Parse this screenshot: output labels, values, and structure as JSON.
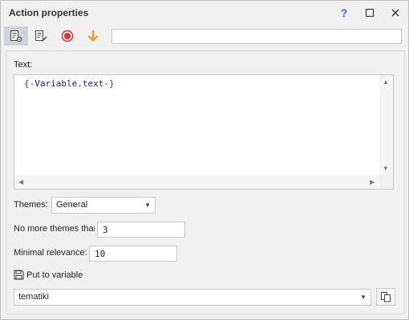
{
  "window": {
    "title": "Action properties",
    "help_glyph": "?",
    "maximize_glyph": "☐",
    "close_glyph": "✕"
  },
  "toolbar": {
    "icons": [
      "action-settings-icon",
      "edit-notes-icon",
      "record-icon",
      "arrow-down-icon"
    ],
    "search_value": ""
  },
  "form": {
    "text_label": "Text:",
    "text_value_brace_open": "{-",
    "text_value_var": "Variable.text",
    "text_value_brace_close": "-}",
    "themes_label": "Themes:",
    "themes_value": "General",
    "max_themes_label": "No more themes thar",
    "max_themes_value": "3",
    "min_relevance_label": "Minimal relevance:",
    "min_relevance_value": "10",
    "put_to_variable_label": "Put to variable",
    "variable_value": "tematiki"
  },
  "colors": {
    "brace": "#a31515",
    "variable": "#1a1aa6",
    "record": "#e03030",
    "arrow": "#f0a020",
    "help": "#2a6fd6"
  }
}
